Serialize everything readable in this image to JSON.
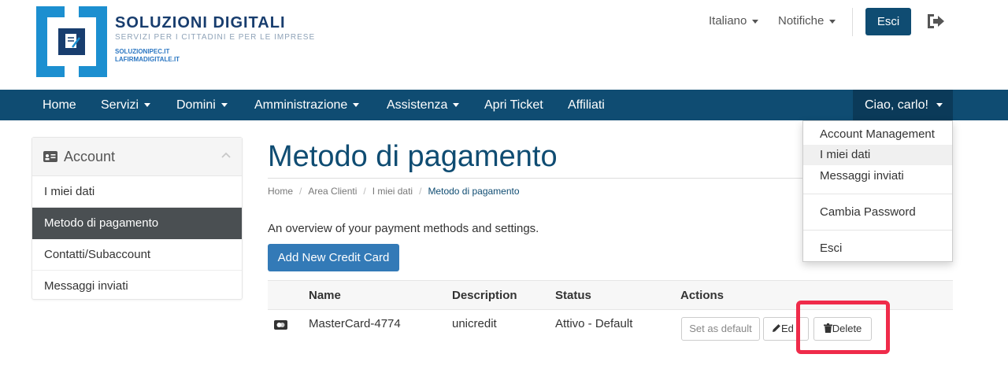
{
  "brand": {
    "title": "SOLUZIONI DIGITALI",
    "subtitle": "SERVIZI PER I CITTADINI E PER LE IMPRESE",
    "link1": "SOLUZIONIPEC.IT",
    "link2": "LAFIRMADIGITALE.IT",
    "colors": {
      "dark": "#183d6e",
      "accent": "#1c8fd0",
      "nav": "#0f4c72"
    }
  },
  "topbar": {
    "language": "Italiano",
    "notifications": "Notifiche",
    "logout_label": "Esci",
    "logout_icon": "sign-out-icon"
  },
  "nav": {
    "items": [
      "Home",
      "Servizi",
      "Domini",
      "Amministrazione",
      "Assistenza",
      "Apri Ticket",
      "Affiliati"
    ],
    "user": "Ciao, carlo!"
  },
  "user_menu": {
    "items": [
      "Account Management",
      "I miei dati",
      "Messaggi inviati",
      "Cambia Password",
      "Esci"
    ]
  },
  "sidebar": {
    "title": "Account",
    "items": [
      "I miei dati",
      "Metodo di pagamento",
      "Contatti/Subaccount",
      "Messaggi inviati"
    ],
    "active": "Metodo di pagamento"
  },
  "main": {
    "title": "Metodo di pagamento",
    "breadcrumb": [
      "Home",
      "Area Clienti",
      "I miei dati",
      "Metodo di pagamento"
    ],
    "intro": "An overview of your payment methods and settings.",
    "add_button": "Add New Credit Card"
  },
  "table": {
    "headers": [
      "Name",
      "Description",
      "Status",
      "Actions"
    ],
    "rows": [
      {
        "name": "MasterCard-4774",
        "description": "unicredit",
        "status": "Attivo - Default",
        "actions": {
          "set_default": "Set as default",
          "edit": "Ed",
          "delete": "Delete"
        }
      }
    ]
  },
  "highlight_color": "#ef2b4a"
}
